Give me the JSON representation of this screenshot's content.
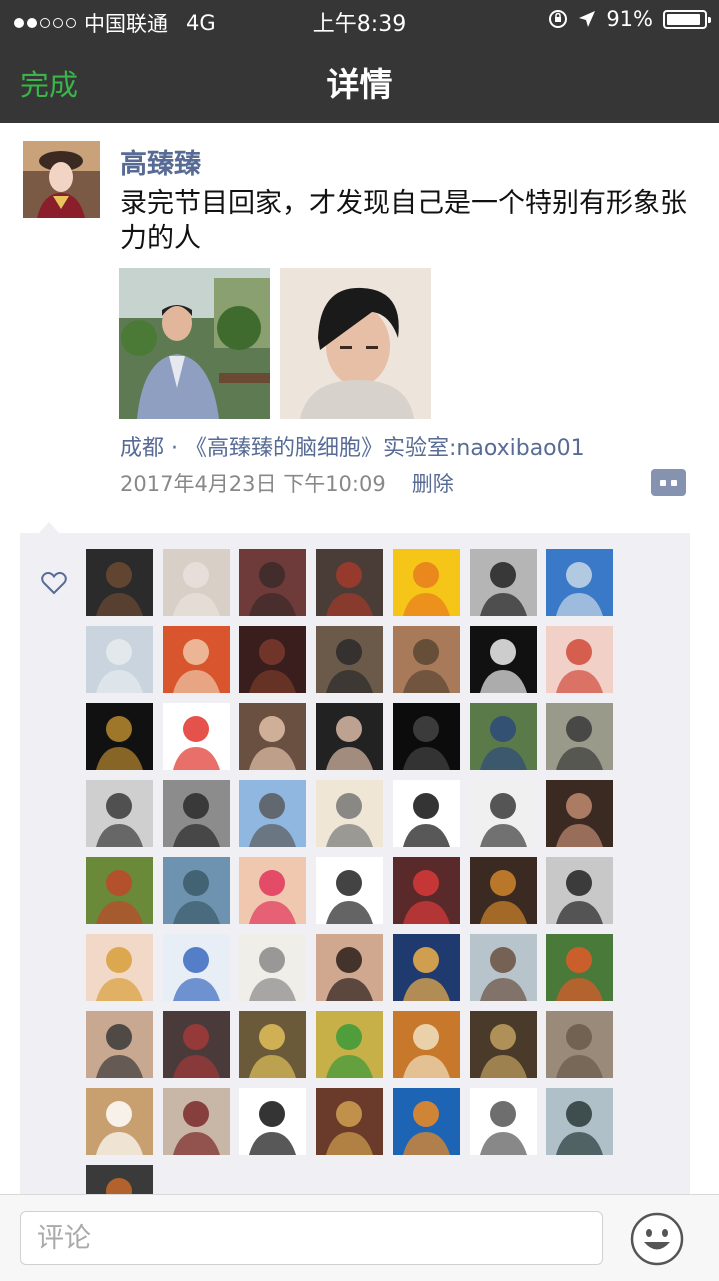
{
  "status_bar": {
    "carrier": "中国联通",
    "network": "4G",
    "time": "上午8:39",
    "battery": "91%",
    "battery_level": 0.91
  },
  "nav": {
    "back_label": "完成",
    "title": "详情"
  },
  "post": {
    "author": "高臻臻",
    "text": "录完节目回家，才发现自己是一个特别有形象张力的人",
    "location": "成都 · 《高臻臻的脑细胞》实验室:naoxibao01",
    "timestamp": "2017年4月23日 下午10:09",
    "delete_label": "删除",
    "photos": [
      {
        "icon": "photo-man-in-suit"
      },
      {
        "icon": "photo-selfie-man"
      }
    ]
  },
  "likes": {
    "icon": "heart-icon",
    "avatar_count": 57
  },
  "comment_bar": {
    "placeholder": "评论",
    "emoji_icon": "smiley-icon"
  },
  "colors": {
    "nav_bg": "#363636",
    "back_green": "#39b54a",
    "link_blue": "#576b95",
    "panel_bg": "#efeff4"
  }
}
